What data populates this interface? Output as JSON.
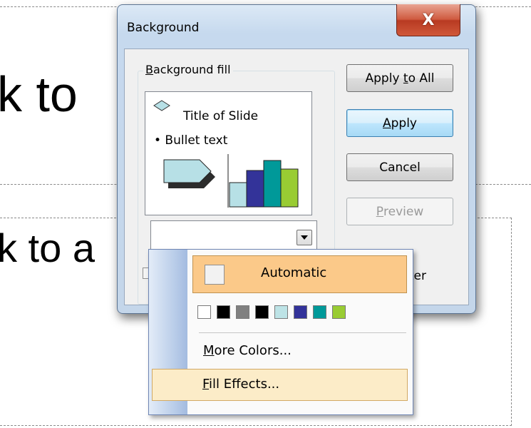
{
  "slide": {
    "text_1": "k to",
    "text_2": "k to a"
  },
  "dialog": {
    "title": "Background",
    "close_label": "X",
    "group_label": "Background fill",
    "preview": {
      "title": "Title of Slide",
      "bullet": "• Bullet text"
    },
    "buttons": {
      "apply_to_all": "Apply to All",
      "apply": "Apply",
      "cancel": "Cancel",
      "preview": "Preview"
    },
    "checkbox_label_visible": "ster"
  },
  "color_menu": {
    "automatic_label": "Automatic",
    "swatches": [
      "#ffffff",
      "#000000",
      "#808080",
      "#000000",
      "#bde3e6",
      "#33339a",
      "#009999",
      "#99cc33"
    ],
    "more_colors_label": "More Colors...",
    "fill_effects_label": "Fill Effects..."
  },
  "preview_colors": {
    "arrow_fill": "#b7e0e6",
    "bars": [
      "#b7e0e6",
      "#333399",
      "#009999",
      "#99cc33"
    ]
  }
}
